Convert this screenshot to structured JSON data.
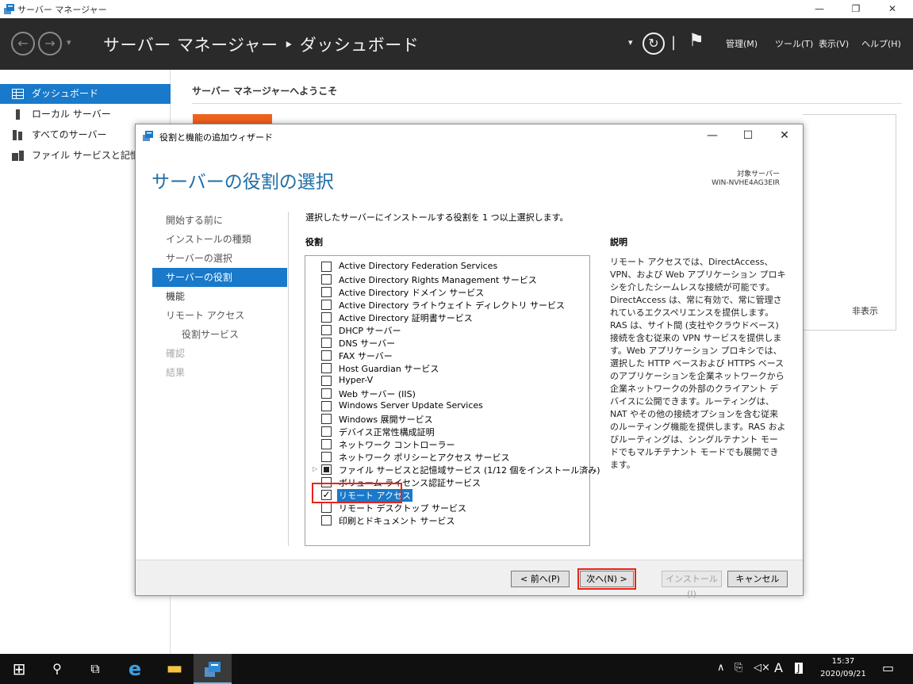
{
  "window": {
    "title": "サーバー マネージャー",
    "controls": {
      "minimize": "—",
      "restore": "❐",
      "close": "✕"
    }
  },
  "header": {
    "back_glyph": "←",
    "forward_glyph": "→",
    "history_glyph": "▾",
    "breadcrumb": "サーバー マネージャー ‣ ダッシュボード",
    "dropdown_glyph": "▾",
    "refresh_glyph": "↻",
    "separator": "|",
    "flag_glyph": "⚑",
    "menus": [
      "管理(M)",
      "ツール(T)",
      "表示(V)",
      "ヘルプ(H)"
    ]
  },
  "sidebar": {
    "items": [
      {
        "label": "ダッシュボード",
        "icon": "dashboard-icon",
        "selected": true
      },
      {
        "label": "ローカル サーバー",
        "icon": "server-icon"
      },
      {
        "label": "すべてのサーバー",
        "icon": "servers-icon"
      },
      {
        "label": "ファイル サービスと記憶域",
        "icon": "storage-icon"
      }
    ]
  },
  "dashboard": {
    "welcome": "サーバー マネージャーへようこそ",
    "hide_link": "非表示"
  },
  "wizard": {
    "title": "役割と機能の追加ウィザード",
    "heading": "サーバーの役割の選択",
    "destination_label": "対象サーバー",
    "destination_name": "WIN-NVHE4AG3EIR",
    "steps": [
      {
        "label": "開始する前に",
        "state": "normal"
      },
      {
        "label": "インストールの種類",
        "state": "normal"
      },
      {
        "label": "サーバーの選択",
        "state": "normal"
      },
      {
        "label": "サーバーの役割",
        "state": "selected"
      },
      {
        "label": "機能",
        "state": "active"
      },
      {
        "label": "リモート アクセス",
        "state": "normal"
      },
      {
        "label": "役割サービス",
        "state": "sub"
      },
      {
        "label": "確認",
        "state": "disabled"
      },
      {
        "label": "結果",
        "state": "disabled"
      }
    ],
    "instruction": "選択したサーバーにインストールする役割を 1 つ以上選択します。",
    "roles_label": "役割",
    "roles": [
      {
        "label": "Active Directory Federation Services",
        "state": "unchecked"
      },
      {
        "label": "Active Directory Rights Management サービス",
        "state": "unchecked"
      },
      {
        "label": "Active Directory ドメイン サービス",
        "state": "unchecked"
      },
      {
        "label": "Active Directory ライトウェイト ディレクトリ サービス",
        "state": "unchecked"
      },
      {
        "label": "Active Directory 証明書サービス",
        "state": "unchecked"
      },
      {
        "label": "DHCP サーバー",
        "state": "unchecked"
      },
      {
        "label": "DNS サーバー",
        "state": "unchecked"
      },
      {
        "label": "FAX サーバー",
        "state": "unchecked"
      },
      {
        "label": "Host Guardian サービス",
        "state": "unchecked"
      },
      {
        "label": "Hyper-V",
        "state": "unchecked"
      },
      {
        "label": "Web サーバー (IIS)",
        "state": "unchecked"
      },
      {
        "label": "Windows Server Update Services",
        "state": "unchecked"
      },
      {
        "label": "Windows 展開サービス",
        "state": "unchecked"
      },
      {
        "label": "デバイス正常性構成証明",
        "state": "unchecked"
      },
      {
        "label": "ネットワーク コントローラー",
        "state": "unchecked"
      },
      {
        "label": "ネットワーク ポリシーとアクセス サービス",
        "state": "unchecked"
      },
      {
        "label": "ファイル サービスと記憶域サービス (1/12 個をインストール済み)",
        "state": "partial",
        "expandable": true
      },
      {
        "label": "ボリューム ライセンス認証サービス",
        "state": "unchecked"
      },
      {
        "label": "リモート アクセス",
        "state": "checked",
        "highlighted": true
      },
      {
        "label": "リモート デスクトップ サービス",
        "state": "unchecked"
      },
      {
        "label": "印刷とドキュメント サービス",
        "state": "unchecked"
      }
    ],
    "description_title": "説明",
    "description": "リモート アクセスでは、DirectAccess、VPN、および Web アプリケーション プロキシを介したシームレスな接続が可能です。DirectAccess は、常に有効で、常に管理されているエクスペリエンスを提供します。RAS は、サイト間 (支社やクラウドベース) 接続を含む従来の VPN サービスを提供します。Web アプリケーション プロキシでは、選択した HTTP ベースおよび HTTPS ベースのアプリケーションを企業ネットワークから企業ネットワークの外部のクライアント デバイスに公開できます。ルーティングは、NAT やその他の接続オプションを含む従来のルーティング機能を提供します。RAS およびルーティングは、シングルテナント モードでもマルチテナント モードでも展開できます。",
    "buttons": {
      "previous": "< 前へ(P)",
      "next": "次へ(N) >",
      "install": "インストール(I)",
      "cancel": "キャンセル"
    },
    "controls": {
      "minimize": "—",
      "maximize": "☐",
      "close": "✕"
    }
  },
  "taskbar": {
    "start_glyph": "⊞",
    "search_glyph": "⚲",
    "taskview_glyph": "⧉",
    "ie_glyph": "e",
    "explorer_glyph": "▬",
    "caret_glyph": "∧",
    "network_glyph": "⎘",
    "volume_glyph": "◁×",
    "ime_glyph": "A",
    "ime2_glyph": "J",
    "notification_glyph": "▭",
    "time": "15:37",
    "date": "2020/09/21"
  },
  "colors": {
    "accent": "#1979ca",
    "header_bg": "#2a2a2a",
    "highlight_red": "#e8231a",
    "orange_tile": "#f2611d",
    "heading_blue": "#1e6ea7"
  }
}
